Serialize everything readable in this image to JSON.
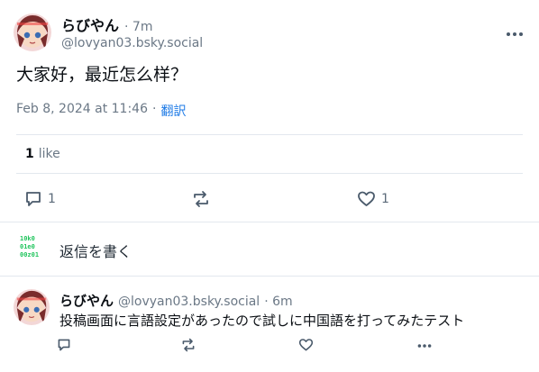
{
  "post": {
    "display_name": "らびやん",
    "age": "· 7m",
    "handle": "@lovyan03.bsky.social",
    "text": "大家好，最近怎么样？",
    "timestamp": "Feb 8, 2024 at 11:46",
    "separator": "·",
    "translate_label": "翻訳",
    "like_count": "1",
    "like_word": "like",
    "reply_count": "1",
    "likes_action_count": "1"
  },
  "composer": {
    "placeholder": "返信を書く",
    "avatar_text_lines": [
      "10k0",
      "01e0",
      "00z01"
    ]
  },
  "reply": {
    "display_name": "らびやん",
    "handle": "@lovyan03.bsky.social",
    "age": "· 6m",
    "text": "投稿画面に言語設定があったので試しに中国語を打ってみたテスト"
  },
  "colors": {
    "accent": "#1d7ae6",
    "action_icon": "#4a5a6b",
    "matrix_green": "#22c55e"
  }
}
